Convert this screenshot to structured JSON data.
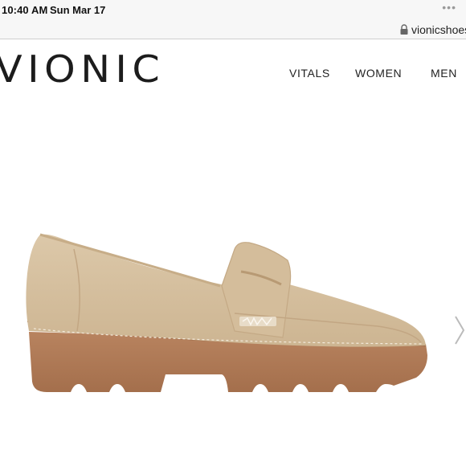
{
  "status_bar": {
    "time": "10:40 AM",
    "date": "Sun Mar 17",
    "menu_dots": "•••"
  },
  "browser": {
    "url": "vionicshoes"
  },
  "site": {
    "logo": "VIONIC",
    "nav": [
      {
        "label": "VITALS"
      },
      {
        "label": "WOMEN"
      },
      {
        "label": "MEN"
      }
    ]
  },
  "product": {
    "image_subject": "tan suede loafer",
    "colors": {
      "upper": "#d6c0a0",
      "sole": "#b07a56",
      "stitching": "#f0e6d6"
    }
  },
  "icons": [
    "lock-icon",
    "chevron-right-icon"
  ]
}
